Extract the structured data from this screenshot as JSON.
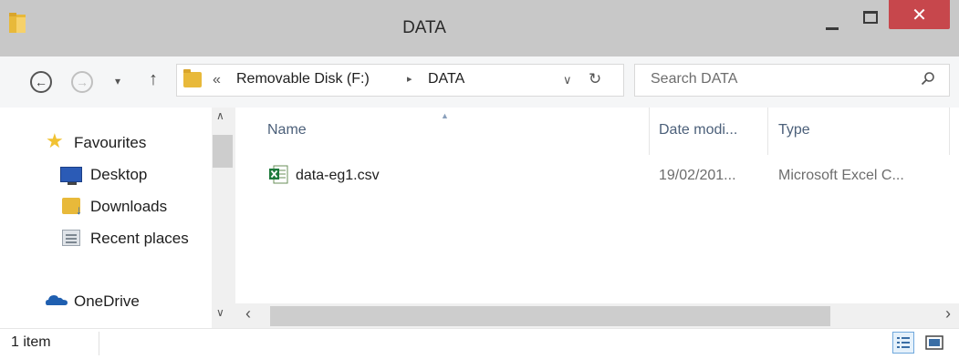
{
  "window": {
    "title": "DATA",
    "close_glyph": "✕"
  },
  "toolbar": {
    "back_glyph": "←",
    "forward_glyph": "→",
    "history_glyph": "▾",
    "up_glyph": "↑",
    "overflow_glyph": "«",
    "breadcrumbs": [
      "Removable Disk (F:)",
      "DATA"
    ],
    "separator_glyph": "▸",
    "dropdown_glyph": "∨",
    "refresh_glyph": "↻"
  },
  "search": {
    "placeholder": "Search DATA"
  },
  "nav": {
    "items": [
      {
        "label": "Favourites",
        "icon": "star-icon"
      },
      {
        "label": "Desktop",
        "icon": "monitor-icon"
      },
      {
        "label": "Downloads",
        "icon": "downloads-icon"
      },
      {
        "label": "Recent places",
        "icon": "recent-places-icon"
      },
      {
        "label": "OneDrive",
        "icon": "onedrive-icon"
      }
    ],
    "scroll_up_glyph": "∧",
    "scroll_down_glyph": "∨"
  },
  "files": {
    "columns": [
      "Name",
      "Date modi...",
      "Type"
    ],
    "sort_glyph": "▲",
    "rows": [
      {
        "name": "data-eg1.csv",
        "date": "19/02/201...",
        "type": "Microsoft Excel C...",
        "icon": "excel-csv-icon"
      }
    ]
  },
  "scrollbar": {
    "left_glyph": "‹",
    "right_glyph": "›"
  },
  "status": {
    "count": "1 item"
  },
  "colors": {
    "title_bar": "#c8c8c8",
    "close_button": "#c7474c",
    "selection_accent": "#6fa8dc"
  }
}
